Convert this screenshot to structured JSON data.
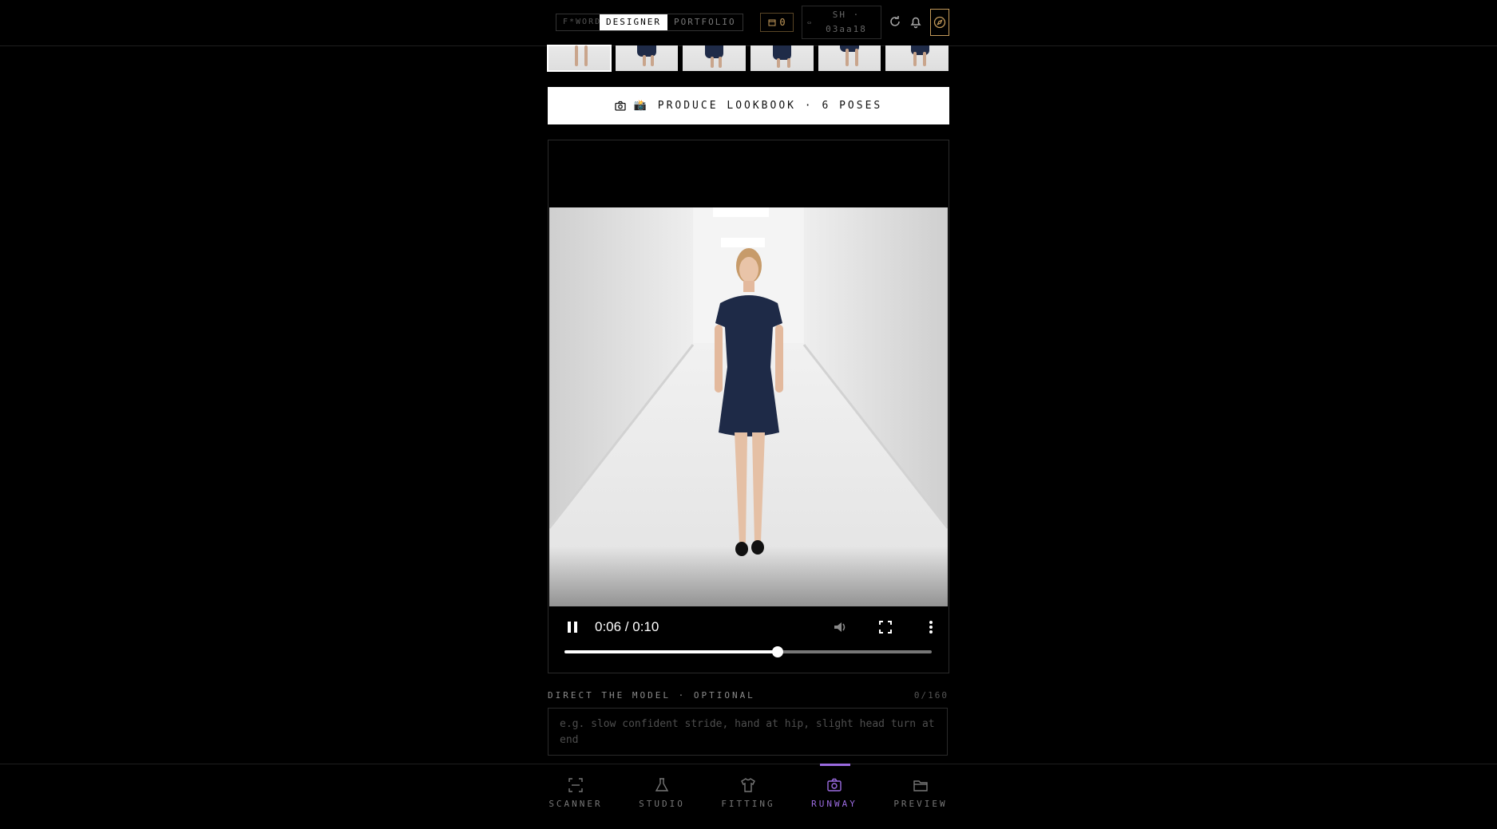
{
  "header": {
    "brand": "F*WORD",
    "modes": [
      "DESIGNER",
      "PORTFOLIO"
    ],
    "active_mode": "DESIGNER",
    "credits": "0",
    "session_label": "SH · 03aa18",
    "icons": [
      "refresh-icon",
      "bell-icon",
      "compass-icon"
    ]
  },
  "produce_button": {
    "label": "📸 PRODUCE LOOKBOOK · 6 POSES"
  },
  "video": {
    "time": "0:06 / 0:10",
    "progress": 0.58
  },
  "direction": {
    "label": "DIRECT THE MODEL · OPTIONAL",
    "count": "0/160",
    "placeholder": "e.g. slow confident stride, hand at hip, slight head turn at end"
  },
  "nav": {
    "items": [
      {
        "label": "SCANNER",
        "icon": "scan-icon"
      },
      {
        "label": "STUDIO",
        "icon": "flask-icon"
      },
      {
        "label": "FITTING",
        "icon": "shirt-icon"
      },
      {
        "label": "RUNWAY",
        "icon": "camera-icon"
      },
      {
        "label": "PREVIEW",
        "icon": "folder-icon"
      }
    ],
    "active": "RUNWAY"
  },
  "colors": {
    "accent_purple": "#9b6be0",
    "gold": "#c49a5a",
    "background": "#000000"
  }
}
